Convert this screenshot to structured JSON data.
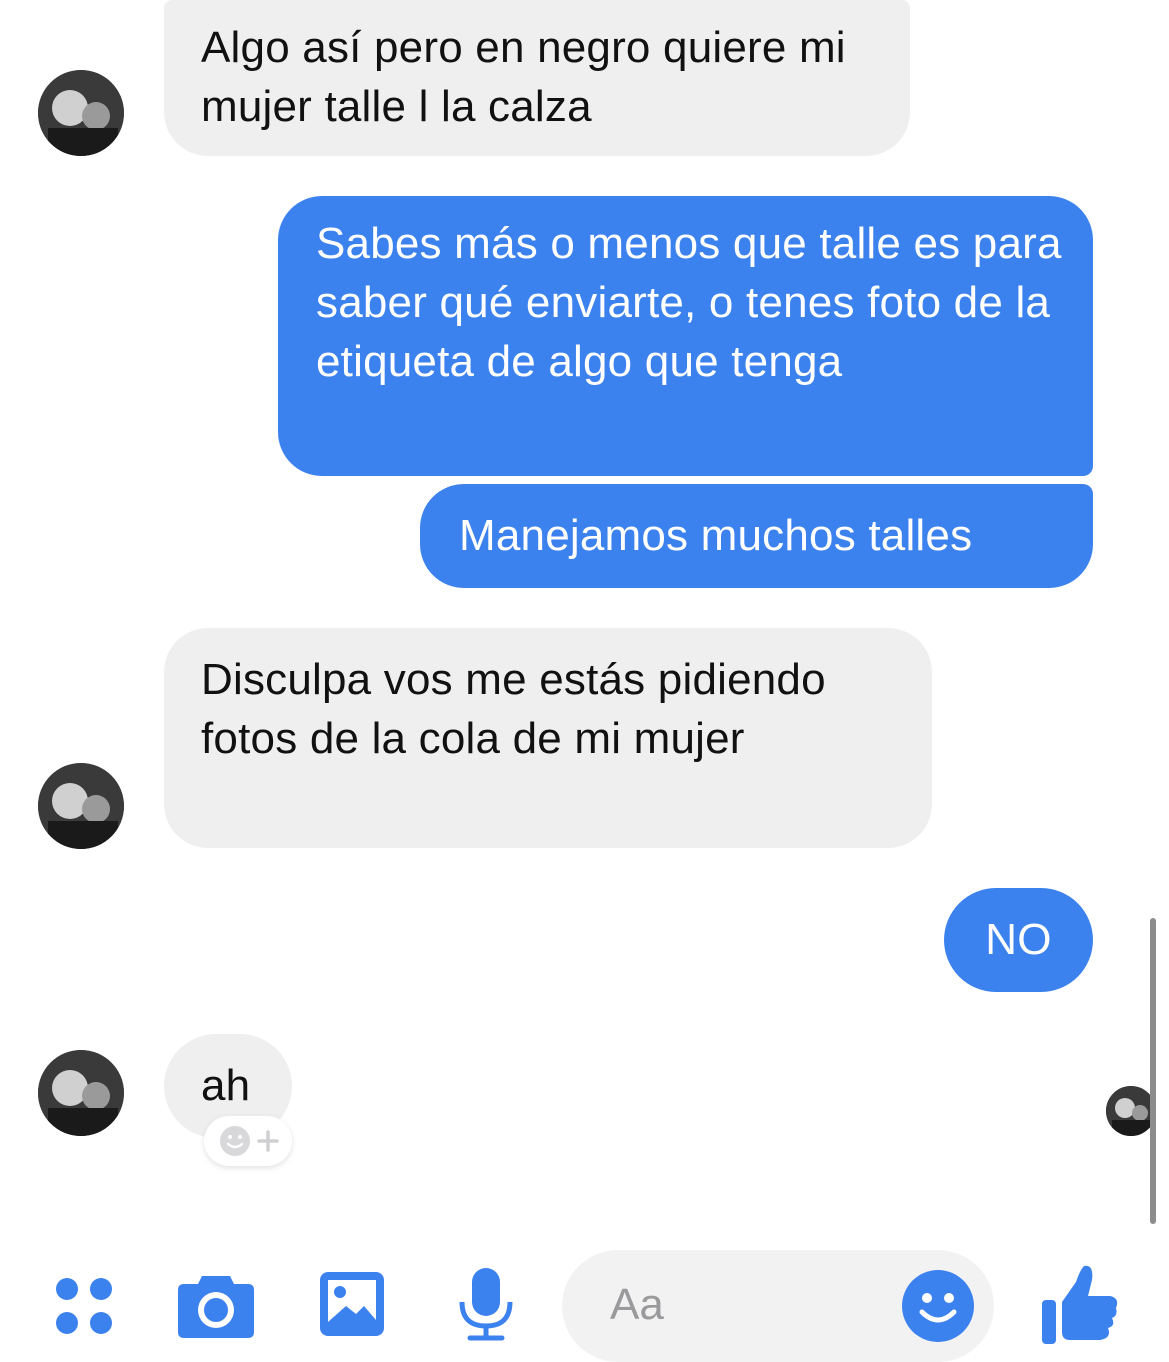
{
  "messages": [
    {
      "from": "them",
      "text": "Algo así pero en negro quiere mi mujer talle l la calza"
    },
    {
      "from": "me",
      "text": "Sabes más o menos que talle es para saber qué enviarte, o tenes foto de la etiqueta de algo que tenga"
    },
    {
      "from": "me",
      "text": "Manejamos muchos talles"
    },
    {
      "from": "them",
      "text": "Disculpa vos me estás pidiendo fotos de la cola de mi mujer"
    },
    {
      "from": "me",
      "text": "NO"
    },
    {
      "from": "them",
      "text": "ah"
    }
  ],
  "composer": {
    "placeholder": "Aa",
    "icons": [
      "more-apps-icon",
      "camera-icon",
      "gallery-icon",
      "microphone-icon",
      "emoji-icon",
      "like-icon"
    ]
  },
  "reaction": {
    "icon": "add-reaction-icon"
  },
  "colors": {
    "accent": "#3c82ef",
    "incoming_bubble": "#efeff0",
    "incoming_text": "#111111",
    "outgoing_text": "#ffffff"
  }
}
